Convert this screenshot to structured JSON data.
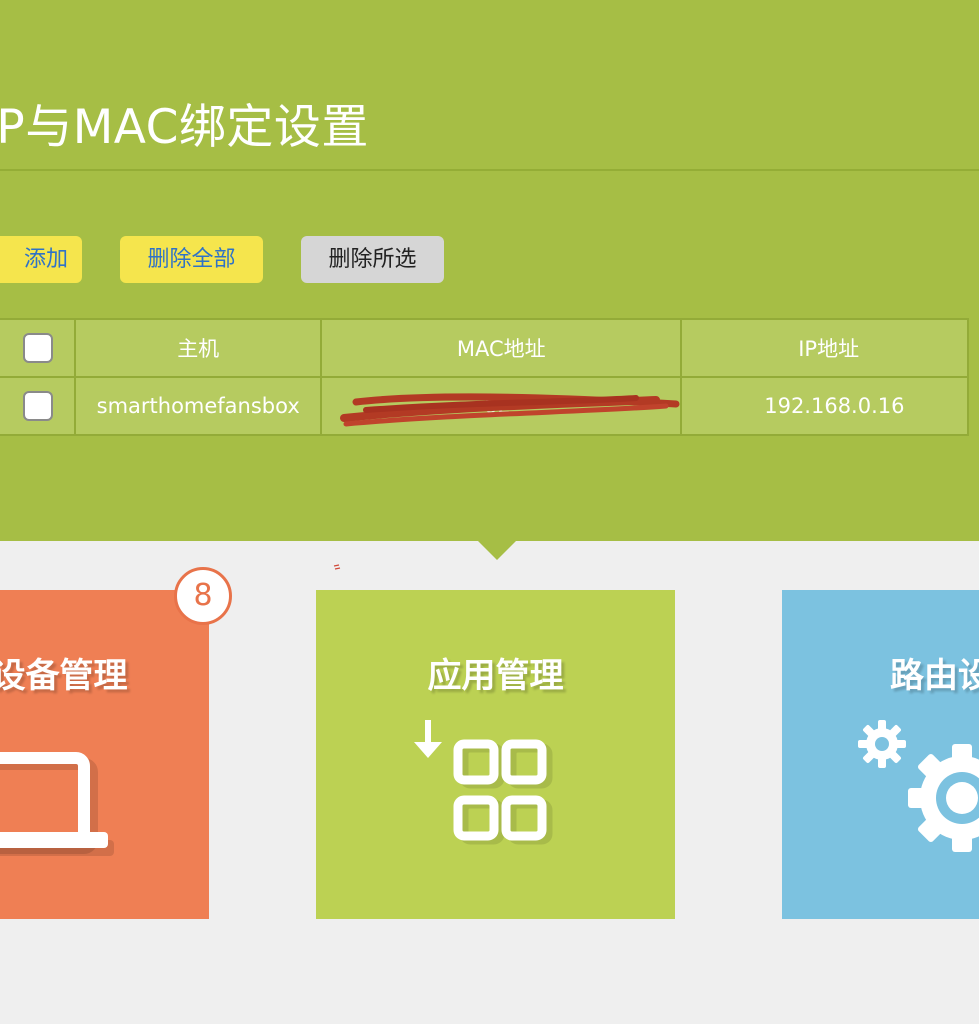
{
  "header": {
    "title": "IP与MAC绑定设置"
  },
  "toolbar": {
    "add_label": "添加",
    "delete_all_label": "删除全部",
    "delete_selected_label": "删除所选"
  },
  "table": {
    "columns": [
      "",
      "主机",
      "MAC地址",
      "IP地址"
    ],
    "rows": [
      {
        "host": "smarthomefansbox",
        "mac": "02-",
        "ip": "192.168.0.16"
      }
    ]
  },
  "tiles": [
    {
      "label": "设备管理",
      "badge": "8",
      "color": "#ef7f54",
      "icon": "laptop-icon"
    },
    {
      "label": "应用管理",
      "color": "#bcd153",
      "icon": "apps-grid-icon"
    },
    {
      "label": "路由设置",
      "color": "#7cc2e0",
      "icon": "gears-icon"
    }
  ],
  "colors": {
    "panel": "#a6be45",
    "button_yellow": "#f5e54d",
    "button_gray": "#d6d6d6",
    "link_blue": "#2f72c7"
  }
}
